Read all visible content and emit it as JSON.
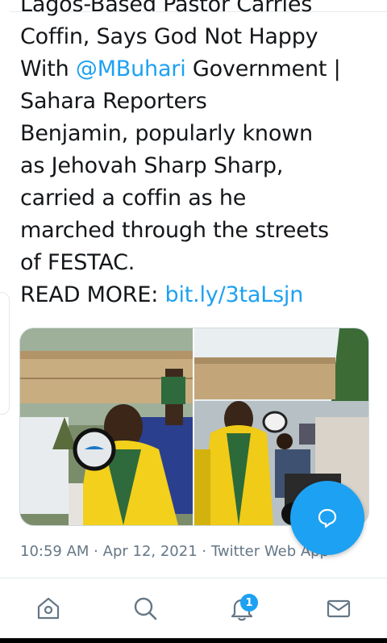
{
  "tweet": {
    "lines": [
      "Lagos-Based Pastor Carries",
      "Coffin, Says God Not Happy",
      "Government |",
      "Sahara Reporters",
      "Benjamin, popularly known",
      "as Jehovah Sharp Sharp,",
      "carried a coffin as he",
      "marched through the streets",
      "of FESTAC."
    ],
    "with_label": "With",
    "mention": "@MBuhari",
    "read_more_label": "READ MORE:",
    "read_more_link": "bit.ly/3taLsjn"
  },
  "media": {
    "photos": [
      {
        "icon": "photo-pastor-with-coffin-and-megaphone"
      },
      {
        "icon": "photo-procession-with-coffin"
      }
    ]
  },
  "meta": {
    "time": "10:59 AM",
    "sep1": " · ",
    "date": "Apr 12, 2021",
    "sep2": " · ",
    "source": "Twitter Web App"
  },
  "bottom_nav": {
    "items": [
      {
        "icon": "home-icon"
      },
      {
        "icon": "search-icon"
      },
      {
        "icon": "bell-icon",
        "badge": "1"
      },
      {
        "icon": "mail-icon"
      }
    ]
  },
  "colors": {
    "accent": "#1da1f2",
    "text": "#14171a",
    "muted": "#657786"
  }
}
